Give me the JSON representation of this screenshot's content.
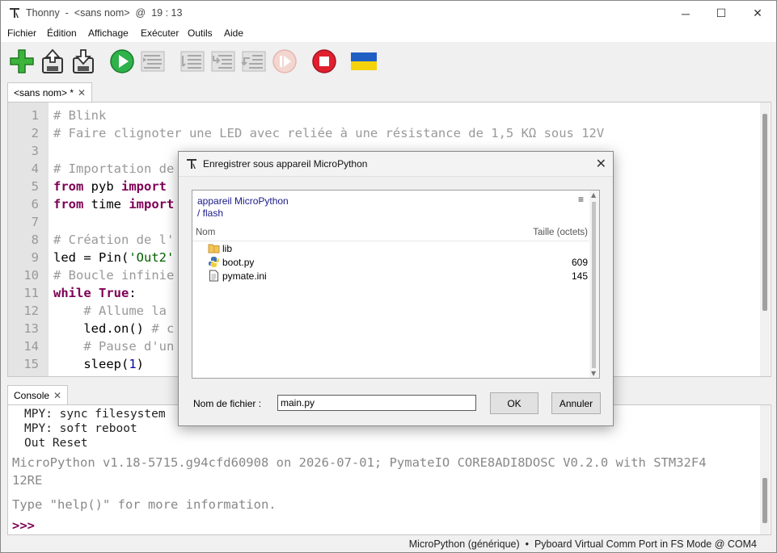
{
  "window": {
    "app_name": "Thonny",
    "title_sep": "-",
    "doc_name": "<sans nom>",
    "at": "@",
    "cursor_pos": "19 : 13",
    "controls": {
      "minimize": "─",
      "maximize": "☐",
      "close": "✕"
    }
  },
  "menu": [
    "Fichier",
    "Édition",
    "Affichage",
    "Exécuter",
    "Outils",
    "Aide"
  ],
  "toolbar_icons": [
    "new-file-icon",
    "open-file-icon",
    "save-file-icon",
    "run-icon",
    "debug-icon",
    "step-over-icon",
    "step-into-icon",
    "step-out-icon",
    "resume-icon",
    "stop-icon",
    "ukraine-flag-icon"
  ],
  "editor": {
    "tab_label": "<sans nom> *",
    "tab_close": "✕",
    "line_numbers": [
      "1",
      "2",
      "3",
      "4",
      "5",
      "6",
      "7",
      "8",
      "9",
      "10",
      "11",
      "12",
      "13",
      "14",
      "15"
    ],
    "lines": [
      [
        {
          "t": "# Blink",
          "c": "cm"
        }
      ],
      [
        {
          "t": "# Faire clignoter une LED avec reliée à une résistance de 1,5 KΩ sous 12V",
          "c": "cm"
        }
      ],
      [
        {
          "t": "",
          "c": ""
        }
      ],
      [
        {
          "t": "# Importation de",
          "c": "cm"
        }
      ],
      [
        {
          "t": "from",
          "c": "kw"
        },
        {
          "t": " pyb ",
          "c": ""
        },
        {
          "t": "import",
          "c": "kw"
        }
      ],
      [
        {
          "t": "from",
          "c": "kw"
        },
        {
          "t": " time ",
          "c": ""
        },
        {
          "t": "import",
          "c": "kw"
        }
      ],
      [
        {
          "t": "",
          "c": ""
        }
      ],
      [
        {
          "t": "# Création de l'",
          "c": "cm"
        }
      ],
      [
        {
          "t": "led = Pin(",
          "c": ""
        },
        {
          "t": "'Out2'",
          "c": "st"
        }
      ],
      [
        {
          "t": "# Boucle infinie",
          "c": "cm"
        }
      ],
      [
        {
          "t": "while",
          "c": "kw"
        },
        {
          "t": " ",
          "c": ""
        },
        {
          "t": "True",
          "c": "kw"
        },
        {
          "t": ":",
          "c": ""
        }
      ],
      [
        {
          "t": "    ",
          "c": ""
        },
        {
          "t": "# Allume la",
          "c": "cm"
        }
      ],
      [
        {
          "t": "    led.on() ",
          "c": ""
        },
        {
          "t": "# c",
          "c": "cm"
        }
      ],
      [
        {
          "t": "    ",
          "c": ""
        },
        {
          "t": "# Pause d'un",
          "c": "cm"
        }
      ],
      [
        {
          "t": "    sleep(",
          "c": ""
        },
        {
          "t": "1",
          "c": "num"
        },
        {
          "t": ")",
          "c": ""
        }
      ]
    ]
  },
  "console": {
    "tab_label": "Console",
    "tab_close": "✕",
    "lines": [
      {
        "text": "MPY: sync filesystem",
        "cls": "small"
      },
      {
        "text": "MPY: soft reboot",
        "cls": "small"
      },
      {
        "text": "Out Reset",
        "cls": "small"
      },
      {
        "text": "MicroPython v1.18-5715.g94cfd60908 on 2026-07-01; PymateIO CORE8ADI8DOSC V0.2.0 with STM32F4",
        "cls": "grey"
      },
      {
        "text": "12RE",
        "cls": "grey"
      },
      {
        "text": "Type \"help()\" for more information.",
        "cls": "grey"
      }
    ],
    "prompt": ">>>"
  },
  "status": {
    "interpreter": "MicroPython (générique)",
    "sep": "•",
    "port": "Pyboard Virtual Comm Port in FS Mode @ COM4"
  },
  "dialog": {
    "title": "Enregistrer sous appareil MicroPython",
    "close": "✕",
    "path_device": "appareil MicroPython",
    "path_dir": "/ flash",
    "menu_glyph": "≡",
    "col_name": "Nom",
    "col_size": "Taille (octets)",
    "files": [
      {
        "icon": "folder-icon",
        "name": "lib",
        "size": ""
      },
      {
        "icon": "python-file-icon",
        "name": "boot.py",
        "size": "609"
      },
      {
        "icon": "text-file-icon",
        "name": "pymate.ini",
        "size": "145"
      }
    ],
    "filename_label": "Nom de fichier :",
    "filename_value": "main.py",
    "ok": "OK",
    "cancel": "Annuler"
  }
}
